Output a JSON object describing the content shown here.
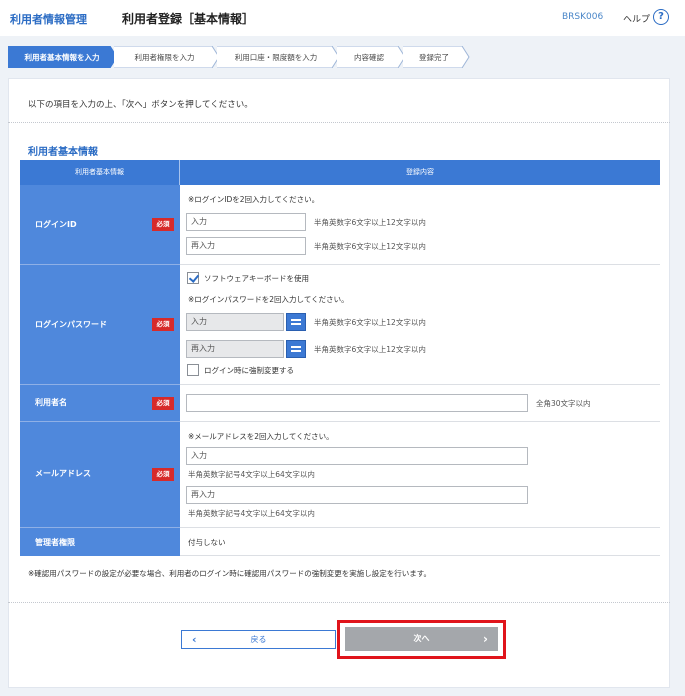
{
  "header": {
    "brand": "利用者情報管理",
    "title": "利用者登録［基本情報］",
    "screen_id": "BRSK006",
    "help_label": "ヘルプ",
    "help_icon": "?"
  },
  "steps": [
    {
      "label": "利用者基本情報を入力",
      "active": true
    },
    {
      "label": "利用者権限を入力",
      "active": false
    },
    {
      "label": "利用口座・限度額を入力",
      "active": false
    },
    {
      "label": "内容確認",
      "active": false
    },
    {
      "label": "登録完了",
      "active": false
    }
  ],
  "instruction": "以下の項目を入力の上、「次へ」ボタンを押してください。",
  "section_title": "利用者基本情報",
  "table": {
    "col_left": "利用者基本情報",
    "col_right": "登録内容",
    "required_badge": "必須",
    "login_id": {
      "label": "ログインID",
      "note": "※ログインIDを2回入力してください。",
      "input1_placeholder": "入力",
      "input2_placeholder": "再入力",
      "hint": "半角英数字6文字以上12文字以内"
    },
    "password": {
      "label": "ログインパスワード",
      "soft_keyboard_label": "ソフトウェアキーボードを使用",
      "soft_keyboard_checked": true,
      "note": "※ログインパスワードを2回入力してください。",
      "input1_placeholder": "入力",
      "input2_placeholder": "再入力",
      "hint": "半角英数字6文字以上12文字以内",
      "force_change_label": "ログイン時に強制変更する",
      "force_change_checked": false
    },
    "user_name": {
      "label": "利用者名",
      "hint": "全角30文字以内"
    },
    "email": {
      "label": "メールアドレス",
      "note": "※メールアドレスを2回入力してください。",
      "input1_placeholder": "入力",
      "input2_placeholder": "再入力",
      "hint": "半角英数字記号4文字以上64文字以内"
    },
    "admin": {
      "label": "管理者権限",
      "value": "付与しない"
    }
  },
  "footnote": "※確認用パスワードの設定が必要な場合、利用者のログイン時に確認用パスワードの強制変更を実施し設定を行います。",
  "buttons": {
    "back_label": "戻る",
    "next_label": "次へ"
  },
  "colors": {
    "accent": "#3b79d4",
    "label_bg": "#4f88dc",
    "required": "#d72a2a",
    "highlight": "#e0141b"
  }
}
